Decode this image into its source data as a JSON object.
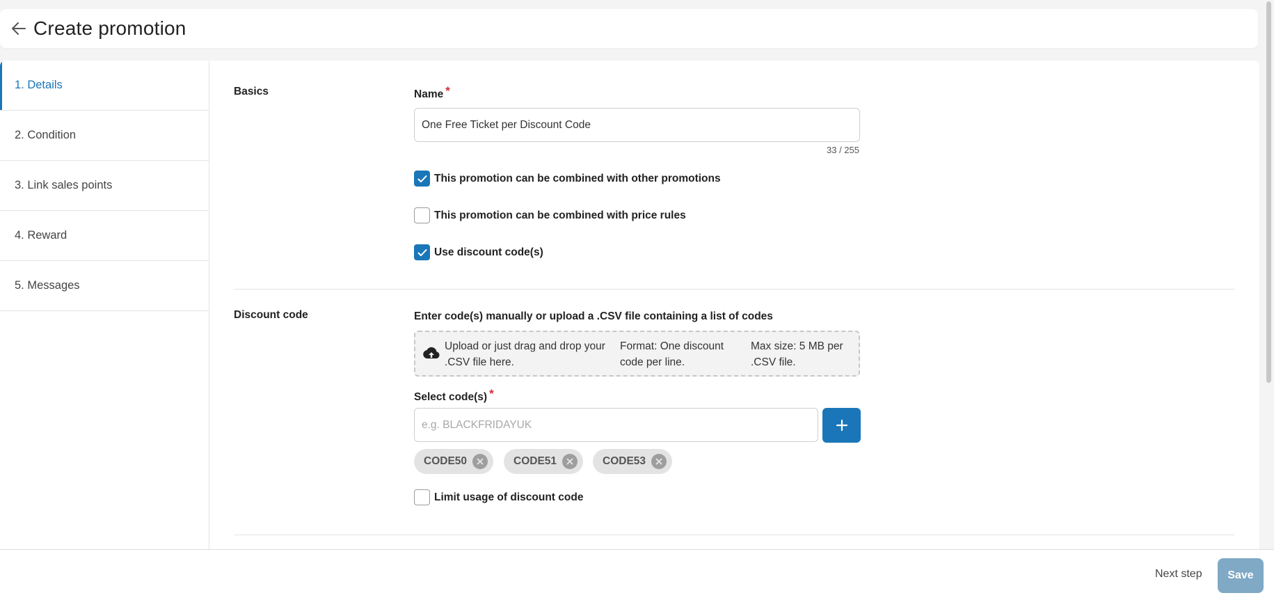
{
  "header": {
    "title": "Create promotion"
  },
  "steps": [
    {
      "label": "1. Details"
    },
    {
      "label": "2. Condition"
    },
    {
      "label": "3. Link sales points"
    },
    {
      "label": "4. Reward"
    },
    {
      "label": "5. Messages"
    }
  ],
  "basics": {
    "section_label": "Basics",
    "name_label": "Name",
    "required_mark": "*",
    "name_value": "One Free Ticket per Discount Code",
    "name_counter": "33 / 255",
    "option_combine_promotions": {
      "label": "This promotion can be combined with other promotions",
      "checked": true
    },
    "option_combine_price_rules": {
      "label": "This promotion can be combined with price rules",
      "checked": false
    },
    "option_use_discount_codes": {
      "label": "Use discount code(s)",
      "checked": true
    }
  },
  "discount": {
    "section_label": "Discount code",
    "upload_heading": "Enter code(s) manually or upload a .CSV file containing a list of codes",
    "upload_line1a": "Upload or just drag and drop your",
    "upload_line1b": ".CSV file here.",
    "upload_line2a": "Format: One discount",
    "upload_line2b": "code per line.",
    "upload_line3a": "Max size: 5 MB per",
    "upload_line3b": ".CSV file.",
    "select_label": "Select code(s)",
    "required_mark": "*",
    "select_placeholder": "e.g. BLACKFRIDAYUK",
    "codes": [
      "CODE50",
      "CODE51",
      "CODE53"
    ],
    "limit_usage": {
      "label": "Limit usage of discount code",
      "checked": false
    }
  },
  "footer": {
    "next_step_label": "Next step",
    "save_label": "Save"
  },
  "colors": {
    "accent": "#1a76b8",
    "save_disabled": "#7fa9c5",
    "required": "#d32f2f"
  }
}
